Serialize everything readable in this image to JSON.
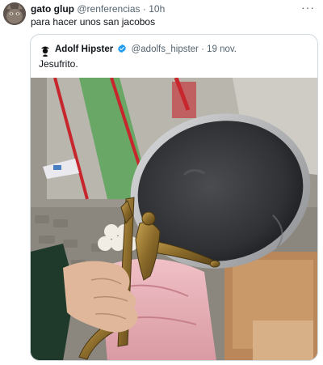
{
  "tweet": {
    "author_name": "gato glup",
    "author_handle": "@renferencias",
    "separator": " · ",
    "time": "10h",
    "more_icon": "more-horizontal-icon",
    "text": "para hacer unos san jacobos"
  },
  "quoted_tweet": {
    "author_name": "Adolf Hipster",
    "verified_icon": "verified-badge-icon",
    "verified_color": "#1d9bf0",
    "author_handle": "@adolfs_hipster",
    "separator": " · ",
    "date": "19 nov.",
    "text": "Jesufrito.",
    "image": "photo of a frying pan whose handle is a brass crucifix, held in a hand"
  },
  "colors": {
    "text_primary": "#0f1419",
    "text_secondary": "#536471",
    "border": "#cfd9de"
  }
}
